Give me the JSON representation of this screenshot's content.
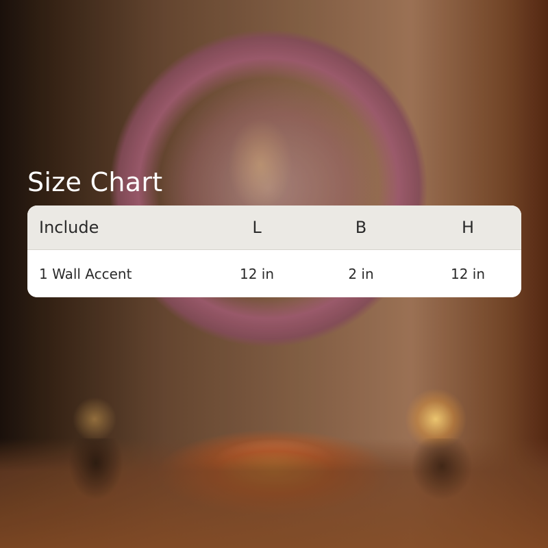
{
  "title": "Size Chart",
  "table": {
    "headers": [
      "Include",
      "L",
      "B",
      "H"
    ],
    "rows": [
      [
        "1 Wall Accent",
        "12 in",
        "2 in",
        "12 in"
      ]
    ]
  }
}
